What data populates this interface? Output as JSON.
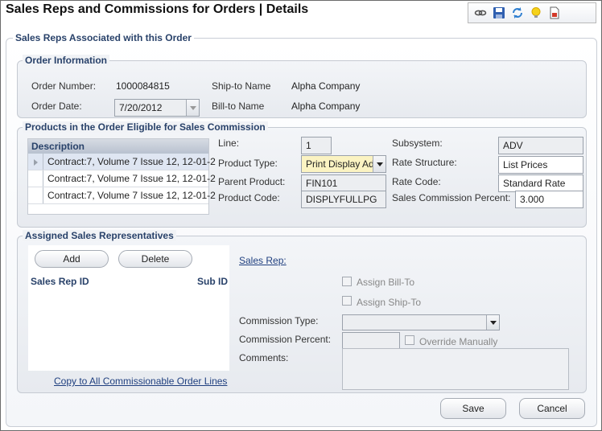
{
  "window": {
    "title": "Sales Reps and Commissions for Orders  |  Details"
  },
  "toolbar": {
    "icons": [
      "link-icon",
      "save-icon",
      "refresh-icon",
      "lightbulb-icon",
      "document-icon"
    ]
  },
  "outer_legend": "Sales Reps Associated with this Order",
  "order_info": {
    "legend": "Order Information",
    "order_number_label": "Order Number:",
    "order_number": "1000084815",
    "order_date_label": "Order Date:",
    "order_date": "7/20/2012",
    "ship_to_label": "Ship-to Name",
    "ship_to": "Alpha Company",
    "bill_to_label": "Bill-to Name",
    "bill_to": "Alpha Company"
  },
  "products": {
    "legend": "Products in the Order Eligible for Sales Commission",
    "grid_header": "Description",
    "rows": [
      "Contract:7, Volume 7 Issue 12, 12-01-2",
      "Contract:7, Volume 7 Issue 12, 12-01-2",
      "Contract:7, Volume 7 Issue 12, 12-01-2"
    ],
    "line_label": "Line:",
    "line": "1",
    "product_type_label": "Product Type:",
    "product_type": "Print Display Ad",
    "parent_product_label": "Parent Product:",
    "parent_product": "FIN101",
    "product_code_label": "Product Code:",
    "product_code": "DISPLYFULLPG",
    "subsystem_label": "Subsystem:",
    "subsystem": "ADV",
    "rate_structure_label": "Rate Structure:",
    "rate_structure": "List Prices",
    "rate_code_label": "Rate Code:",
    "rate_code": "Standard Rate",
    "commission_pct_label": "Sales Commission Percent:",
    "commission_pct": "3.000"
  },
  "reps": {
    "legend": "Assigned Sales Representatives",
    "add_label": "Add",
    "delete_label": "Delete",
    "col_id": "Sales Rep ID",
    "col_sub": "Sub ID",
    "copy_link": "Copy to All Commissionable Order Lines",
    "sales_rep_link": "Sales Rep:",
    "assign_bill_to": "Assign Bill-To",
    "assign_ship_to": "Assign Ship-To",
    "commission_type_label": "Commission Type:",
    "commission_type": "",
    "commission_percent_label": "Commission Percent:",
    "commission_percent": "",
    "override_label": "Override Manually",
    "comments_label": "Comments:",
    "comments": ""
  },
  "footer": {
    "save_label": "Save",
    "cancel_label": "Cancel"
  }
}
